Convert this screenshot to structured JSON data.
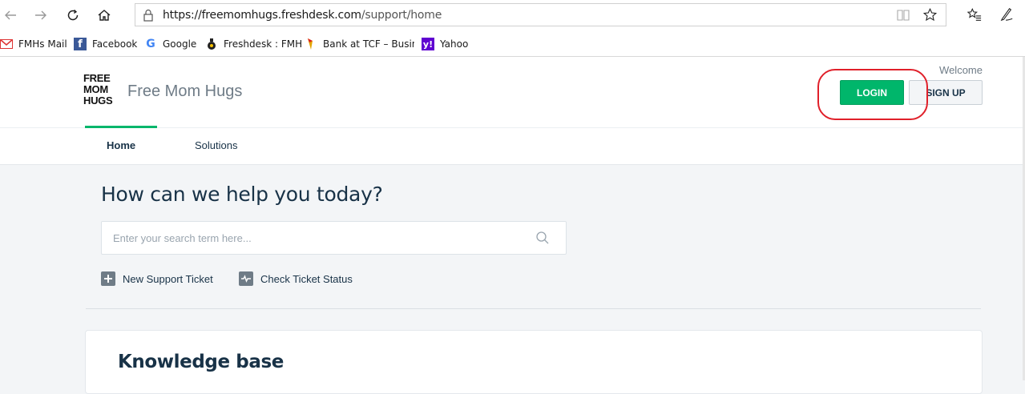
{
  "browser": {
    "url_host": "https://freemomhugs.freshdesk.com",
    "url_path": "/support/home",
    "bookmarks": [
      {
        "label": "FMHs Mail",
        "icon": "gmail-icon"
      },
      {
        "label": "Facebook",
        "icon": "facebook-icon"
      },
      {
        "label": "Google",
        "icon": "google-icon"
      },
      {
        "label": "Freshdesk : FMH",
        "icon": "freshdesk-icon"
      },
      {
        "label": "Bank at TCF – Busines",
        "icon": "tcf-icon"
      },
      {
        "label": "Yahoo",
        "icon": "yahoo-icon"
      }
    ]
  },
  "header": {
    "logo_lines": [
      "FREE",
      "MOM",
      "HUGS"
    ],
    "brand_name": "Free Mom Hugs",
    "welcome": "Welcome",
    "login_label": "LOGIN",
    "signup_label": "SIGN UP"
  },
  "tabs": [
    {
      "label": "Home",
      "active": true
    },
    {
      "label": "Solutions",
      "active": false
    }
  ],
  "hero": {
    "title": "How can we help you today?",
    "search_placeholder": "Enter your search term here...",
    "actions": [
      {
        "label": "New Support Ticket",
        "icon": "plus-icon"
      },
      {
        "label": "Check Ticket Status",
        "icon": "pulse-icon"
      }
    ]
  },
  "knowledge_base": {
    "title": "Knowledge base"
  },
  "colors": {
    "accent": "#00b66b",
    "annotation": "#e0202a",
    "text": "#183247"
  }
}
